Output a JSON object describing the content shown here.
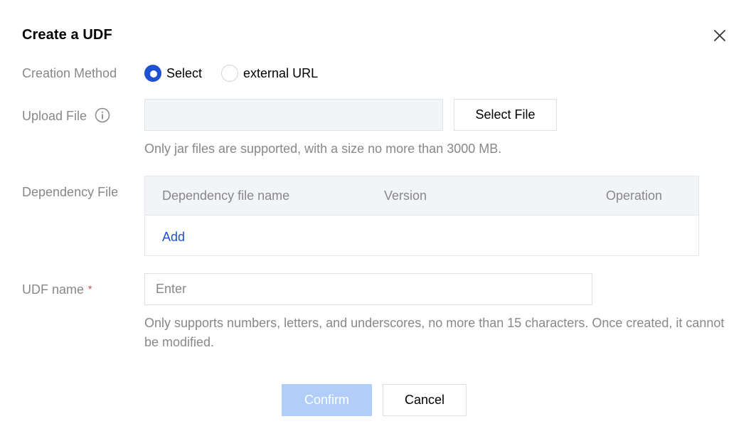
{
  "dialog": {
    "title": "Create a UDF",
    "close_icon": "close-icon"
  },
  "creation_method": {
    "label": "Creation Method",
    "options": [
      {
        "label": "Select",
        "checked": true
      },
      {
        "label": "external URL",
        "checked": false
      }
    ]
  },
  "upload_file": {
    "label": "Upload File",
    "info_icon": "info-icon",
    "value": "",
    "button_label": "Select File",
    "hint": "Only jar files are supported, with a size no more than 3000 MB."
  },
  "dependency_file": {
    "label": "Dependency File",
    "columns": [
      "Dependency file name",
      "Version",
      "Operation"
    ],
    "add_label": "Add"
  },
  "udf_name": {
    "label": "UDF name",
    "required_mark": "*",
    "placeholder": "Enter",
    "value": "",
    "hint": "Only supports numbers, letters, and underscores, no more than 15 characters. Once created, it cannot be modified."
  },
  "footer": {
    "confirm_label": "Confirm",
    "cancel_label": "Cancel"
  },
  "colors": {
    "accent": "#2151d1",
    "confirm_disabled": "#b3cdf9",
    "required": "#e54545",
    "label": "#888888"
  }
}
